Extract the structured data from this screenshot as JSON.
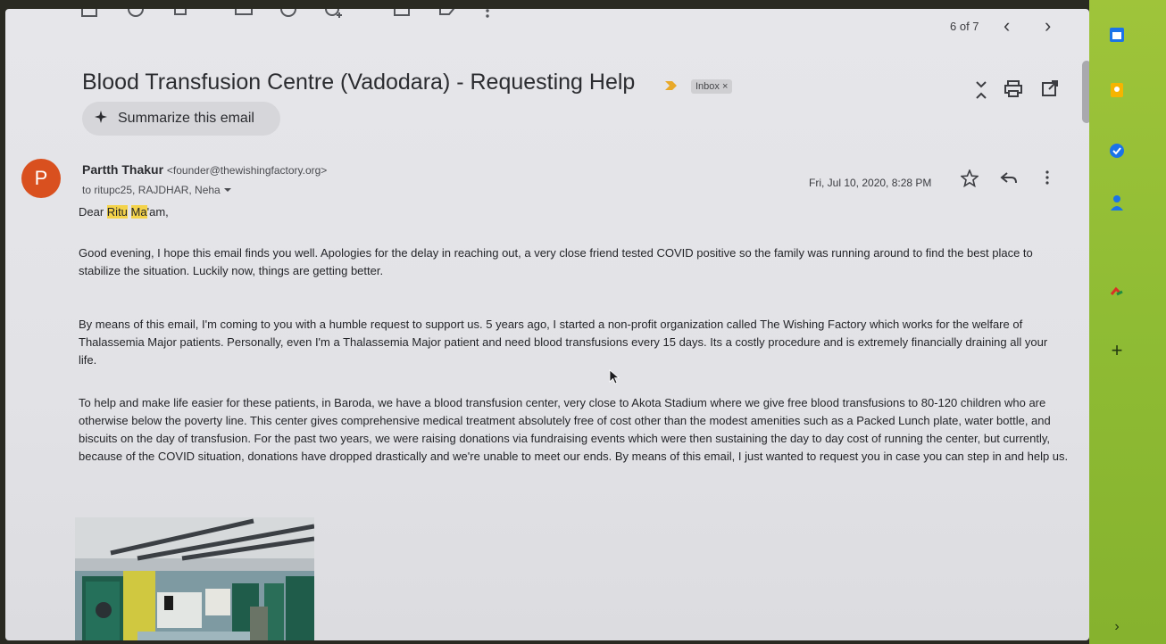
{
  "toolbar": {
    "counter": "6 of 7",
    "prev_label": "‹",
    "next_label": "›"
  },
  "email": {
    "subject": "Blood Transfusion Centre (Vadodara) - Requesting Help",
    "label": "Inbox ×",
    "summarize_label": "Summarize this email",
    "sender_name": "Partth Thakur",
    "sender_email": "<founder@thewishingfactory.org>",
    "recipients": "to ritupc25, RAJDHAR, Neha",
    "date": "Fri, Jul 10, 2020, 8:28 PM",
    "avatar_letter": "P",
    "greeting_pre": "Dear ",
    "greeting_hl1": "Ritu",
    "greeting_mid": " ",
    "greeting_hl2": "Ma",
    "greeting_post": "'am,",
    "para1": "Good evening, I hope this email finds you well. Apologies for the delay in reaching out, a very close friend tested COVID positive so the family was running around to find the best place to stabilize the situation. Luckily now, things are getting better.",
    "para2": "By means of this email, I'm coming to you with a humble request to support us. 5 years ago, I started a non-profit organization called The Wishing Factory which works for the welfare of Thalassemia Major patients. Personally, even I'm a Thalassemia Major patient and need blood transfusions every 15 days. Its a costly procedure and is extremely financially draining all your life.",
    "para3": "To help and make life easier for these patients, in Baroda, we have a blood transfusion center, very close to Akota Stadium where we give free blood transfusions to 80-120 children who are otherwise below the poverty line. This center gives comprehensive medical treatment absolutely free of cost other than the modest amenities such as a Packed Lunch plate, water bottle, and biscuits on the day of transfusion. For the past two years, we were raising donations via fundraising events which were then sustaining the day to day cost of running the center, but currently, because of the COVID situation, donations have dropped drastically and we're unable to meet our ends. By means of this email, I just wanted to request you in case you can step in and help us."
  },
  "rail": {
    "add_label": "+",
    "expand_label": "›"
  },
  "colors": {
    "avatar": "#d9501f",
    "highlight": "#f4d34a",
    "rail": "#8fbc34",
    "important": "#e8a92a"
  }
}
